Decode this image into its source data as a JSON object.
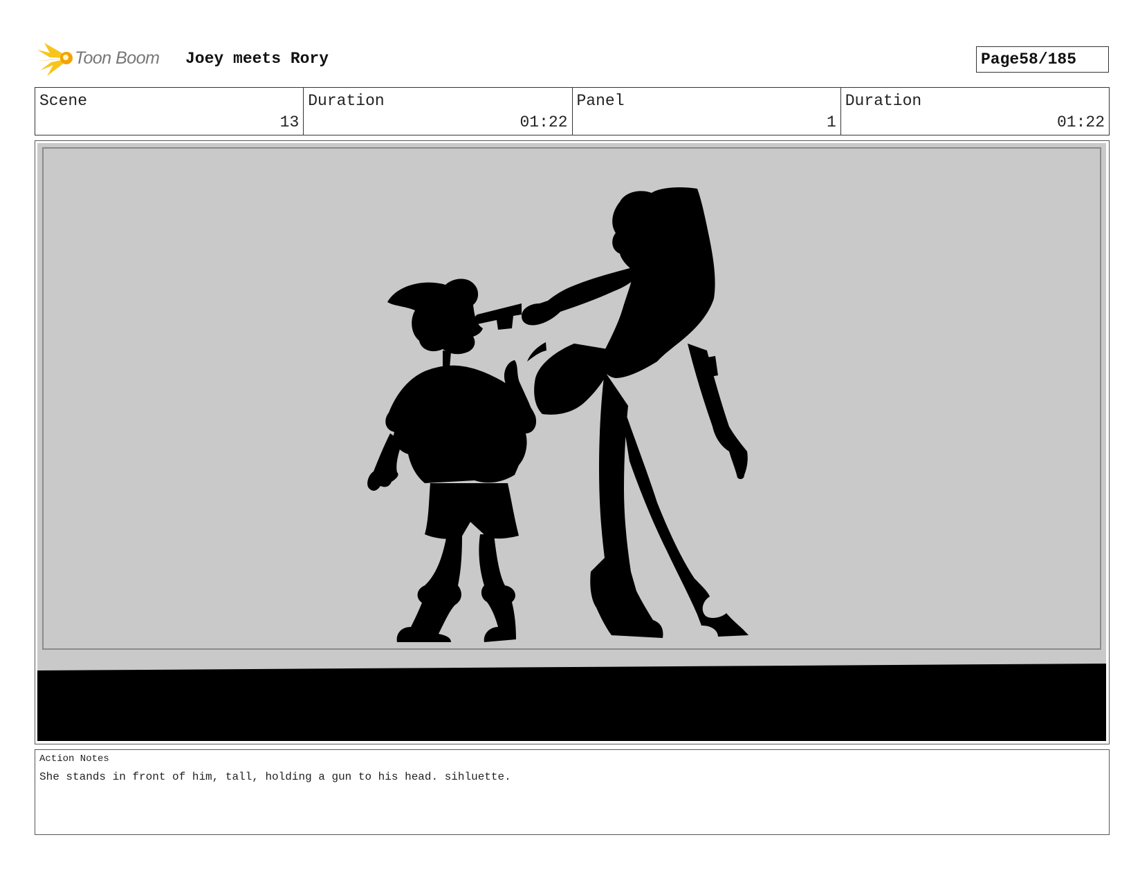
{
  "header": {
    "logo_text": "Toon Boom",
    "project_title": "Joey meets Rory",
    "page_label": "Page",
    "page_value": "58/185"
  },
  "info": {
    "scene_label": "Scene",
    "scene_value": "13",
    "scene_duration_label": "Duration",
    "scene_duration_value": "01:22",
    "panel_label": "Panel",
    "panel_value": "1",
    "panel_duration_label": "Duration",
    "panel_duration_value": "01:22"
  },
  "panel": {
    "background_color": "#c9c9c9",
    "silhouette_color": "#000000"
  },
  "notes": {
    "label": "Action Notes",
    "text": "She stands in front of him, tall, holding a gun to his head. sihluette."
  }
}
